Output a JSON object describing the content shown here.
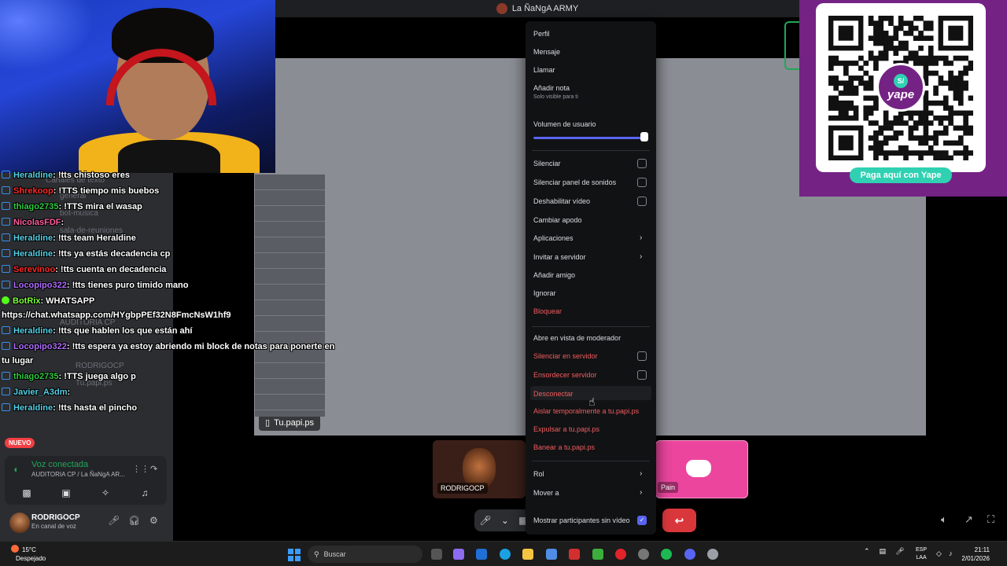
{
  "window": {
    "title": "La ÑaNgA ARMY"
  },
  "channel_list_faint": [
    "Canales de texto",
    "general",
    "bot-musica",
    "sala-de-reuniones",
    "AUDITORIA CP",
    "RODRIGOCP",
    "Tu.papi.ps"
  ],
  "stage": {
    "tile_label": "Tu.papi.ps"
  },
  "chat": [
    {
      "user": "Heraldine",
      "color": "teal",
      "text": ": !tts chistoso eres"
    },
    {
      "user": "Shrekoop",
      "color": "red",
      "text": ": !TTS tiempo mis buebos"
    },
    {
      "user": "thiago2735",
      "color": "green",
      "text": ": !TTS mira el wasap"
    },
    {
      "user": "NicolasFDF",
      "color": "pink",
      "text": ":"
    },
    {
      "user": "Heraldine",
      "color": "teal",
      "text": ": !tts team Heraldine"
    },
    {
      "user": "Heraldine",
      "color": "teal",
      "text": ": !tts ya estás decadencia cp"
    },
    {
      "user": "Serevinoo",
      "color": "red",
      "text": ": !tts cuenta en decadencia"
    },
    {
      "user": "Locopipo322",
      "color": "purple",
      "text": ": !tts tienes puro timido mano"
    },
    {
      "user": "BotRix",
      "color": "lime",
      "text": ": WHATSAPP"
    },
    {
      "user": "",
      "color": "white",
      "text": "https://chat.whatsapp.com/HYgbpPEf32N8FmcNsW1hf9"
    },
    {
      "user": "Heraldine",
      "color": "teal",
      "text": ": !tts que hablen los que están ahí"
    },
    {
      "user": "Locopipo322",
      "color": "purple",
      "text": ": !tts espera ya estoy abriendo mi block de notas para ponerte en"
    },
    {
      "user": "",
      "color": "white",
      "text": "tu lugar"
    },
    {
      "user": "thiago2735",
      "color": "green",
      "text": ": !TTS juega algo p"
    },
    {
      "user": "Javier_A3dm",
      "color": "teal",
      "text": ":"
    },
    {
      "user": "Heraldine",
      "color": "teal",
      "text": ": !tts hasta el pincho"
    }
  ],
  "sidebar": {
    "nuevo_badge": "NUEVO",
    "voice": {
      "title": "Voz conectada",
      "subtitle": "AUDITORIA CP / La ÑaNgA AR..."
    },
    "user": {
      "name": "RODRIGOCP",
      "status": "En canal de voz"
    }
  },
  "tiles": [
    {
      "label": "RODRIGOCP"
    },
    {
      "label": "Pain"
    }
  ],
  "context_menu": {
    "items": [
      {
        "label": "Perfil"
      },
      {
        "label": "Mensaje"
      },
      {
        "label": "Llamar"
      },
      {
        "label": "Añadir nota",
        "sub": "Solo visible para ti"
      },
      {
        "label": "Volumen de usuario",
        "volume": 1.0
      },
      {
        "label": "Silenciar",
        "checked": false
      },
      {
        "label": "Silenciar panel de sonidos",
        "checked": false
      },
      {
        "label": "Deshabilitar vídeo",
        "checked": false
      },
      {
        "label": "Cambiar apodo"
      },
      {
        "label": "Aplicaciones"
      },
      {
        "label": "Invitar a servidor"
      },
      {
        "label": "Añadir amigo"
      },
      {
        "label": "Ignorar"
      },
      {
        "label": "Bloquear"
      },
      {
        "label": "Abre en vista de moderador"
      },
      {
        "label": "Silenciar en servidor",
        "checked": false
      },
      {
        "label": "Ensordecer servidor",
        "checked": false
      },
      {
        "label": "Desconectar"
      },
      {
        "label": "Aislar temporalmente a tu.papi.ps"
      },
      {
        "label": "Expulsar a tu.papi.ps"
      },
      {
        "label": "Banear a tu.papi.ps"
      },
      {
        "label": "Rol"
      },
      {
        "label": "Mover a"
      },
      {
        "label": "Mostrar participantes sin vídeo",
        "checked": true
      }
    ]
  },
  "qr_panel": {
    "button": "Paga aquí con Yape",
    "logo_text": "yape",
    "logo_badge": "S/"
  },
  "taskbar": {
    "weather_temp": "15°C",
    "weather_desc": "Despejado",
    "search_placeholder": "Buscar",
    "lang_1": "ESP",
    "lang_2": "LAA",
    "time": "21:11",
    "date": "2/01/2026"
  },
  "colors": {
    "accent": "#5865f2",
    "danger": "#f05d5f",
    "hangup": "#da373c",
    "yape": "#742284",
    "yape_btn": "#2fd1b2"
  }
}
